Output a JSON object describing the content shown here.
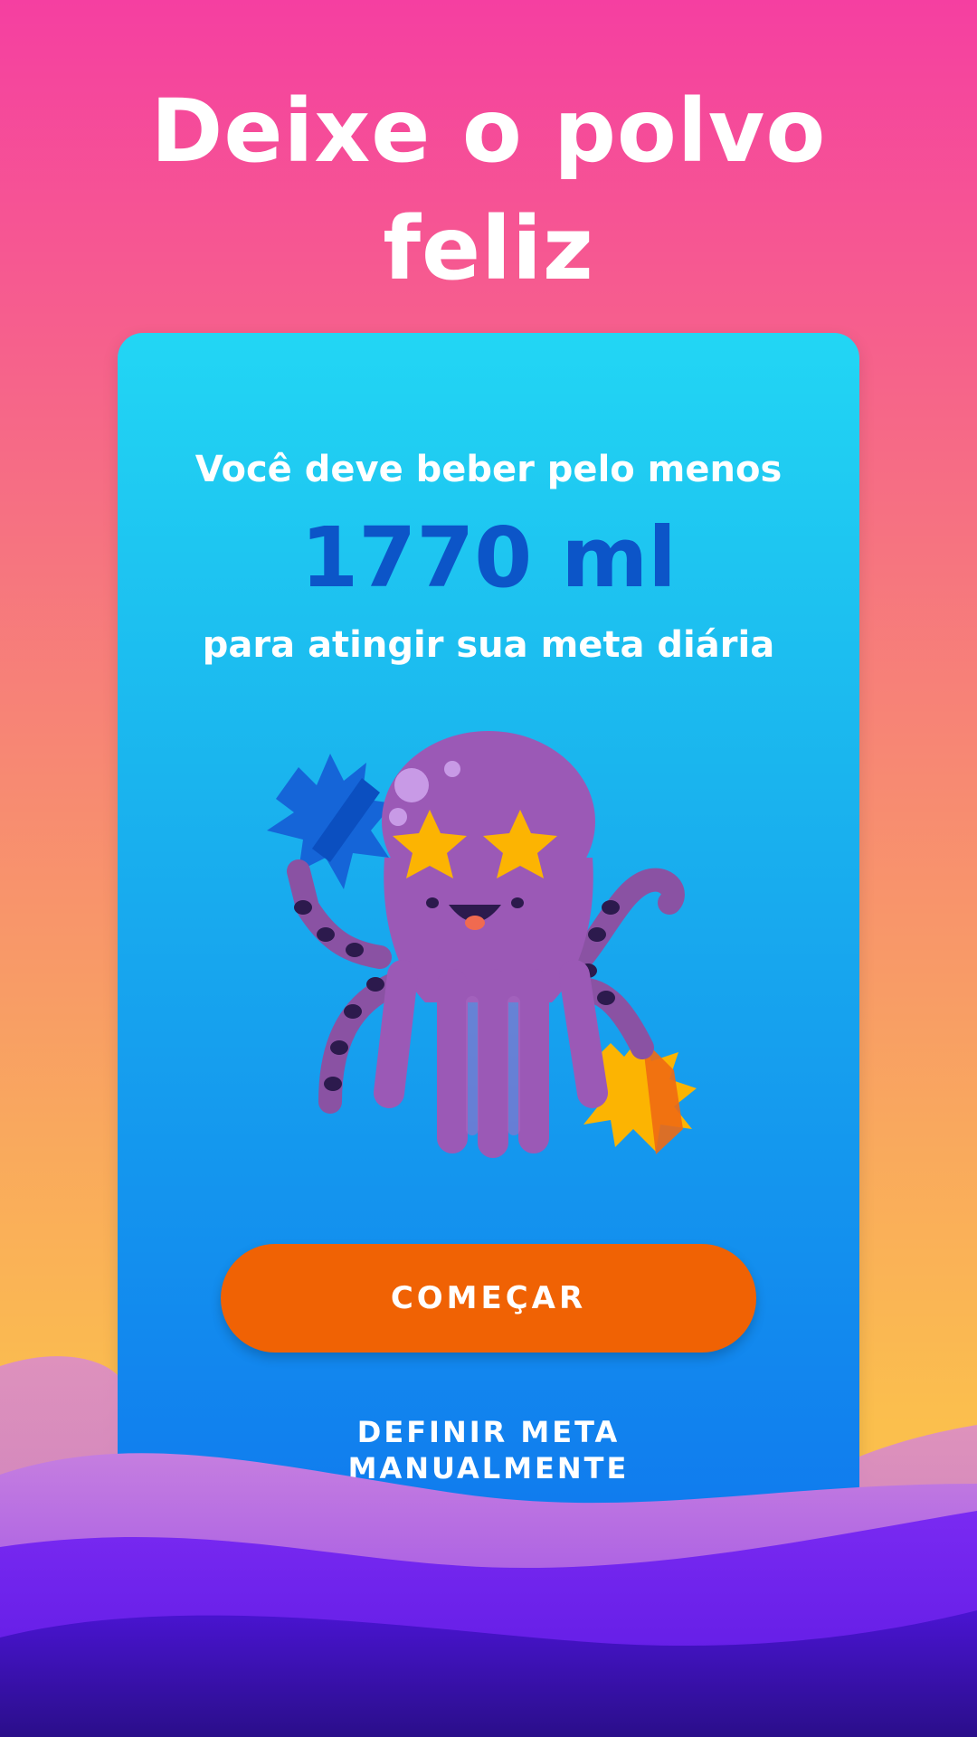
{
  "headline": {
    "line1": "Deixe o polvo",
    "line2": "feliz"
  },
  "card": {
    "intro_top": "Você deve beber pelo menos",
    "goal_value": "1770 ml",
    "intro_bottom": "para atingir sua meta diária",
    "mascot_icon": "octopus-illustration-icon",
    "start_button": "COMEÇAR",
    "manual_link_line1": "DEFINIR META",
    "manual_link_line2": "MANUALMENTE"
  },
  "colors": {
    "accent_orange": "#f06204",
    "goal_blue": "#0c55c8",
    "octopus_purple": "#9b59b6",
    "star_yellow": "#fcb402"
  }
}
